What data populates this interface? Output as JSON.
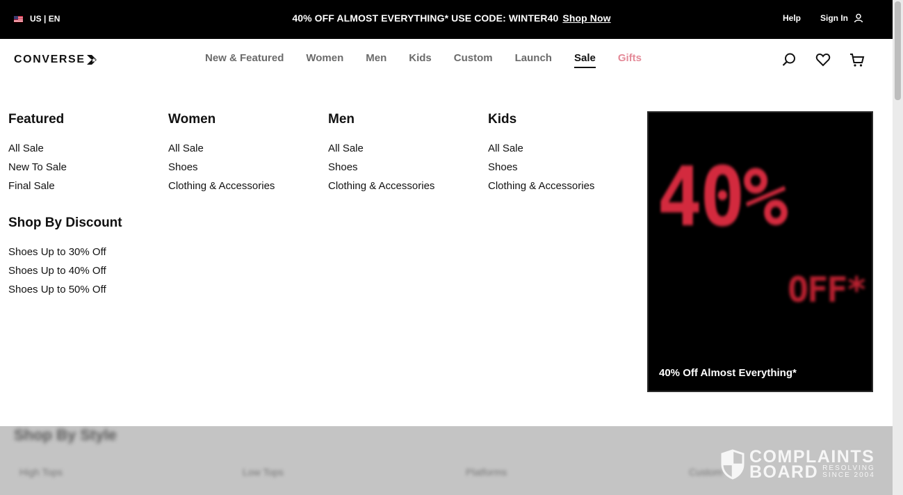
{
  "promo_bar": {
    "locale": "US | EN",
    "message": "40% OFF ALMOST EVERYTHING* USE CODE: WINTER40",
    "shop_now": "Shop Now",
    "help": "Help",
    "sign_in": "Sign In"
  },
  "header": {
    "logo": "CONVERSE",
    "nav": [
      {
        "label": "New & Featured"
      },
      {
        "label": "Women"
      },
      {
        "label": "Men"
      },
      {
        "label": "Kids"
      },
      {
        "label": "Custom"
      },
      {
        "label": "Launch"
      },
      {
        "label": "Sale",
        "active": true
      },
      {
        "label": "Gifts",
        "color": "#e48a98"
      }
    ],
    "icons": [
      "search-icon",
      "heart-icon",
      "cart-icon"
    ]
  },
  "mega_menu": {
    "featured": {
      "title": "Featured",
      "links": [
        "All Sale",
        "New To Sale",
        "Final Sale"
      ]
    },
    "shop_by_discount": {
      "title": "Shop By Discount",
      "links": [
        "Shoes Up to 30% Off",
        "Shoes Up to 40% Off",
        "Shoes Up to 50% Off"
      ]
    },
    "women": {
      "title": "Women",
      "links": [
        "All Sale",
        "Shoes",
        "Clothing & Accessories"
      ]
    },
    "men": {
      "title": "Men",
      "links": [
        "All Sale",
        "Shoes",
        "Clothing & Accessories"
      ]
    },
    "kids": {
      "title": "Kids",
      "links": [
        "All Sale",
        "Shoes",
        "Clothing & Accessories"
      ]
    },
    "promo": {
      "big_text": "40%",
      "off_text": "OFF*",
      "caption": "40% Off Almost Everything*"
    }
  },
  "background": {
    "section_title": "Shop By Style",
    "items": [
      "High Tops",
      "Low Tops",
      "Platforms",
      "Custom"
    ]
  },
  "watermark": {
    "main1": "COMPLAINTS",
    "main2": "BOARD",
    "sub1": "RESOLVING",
    "sub2": "SINCE 2004"
  },
  "colors": {
    "accent_sale": "#111111",
    "gifts": "#e48a98",
    "promo_red": "#d32a3e"
  }
}
